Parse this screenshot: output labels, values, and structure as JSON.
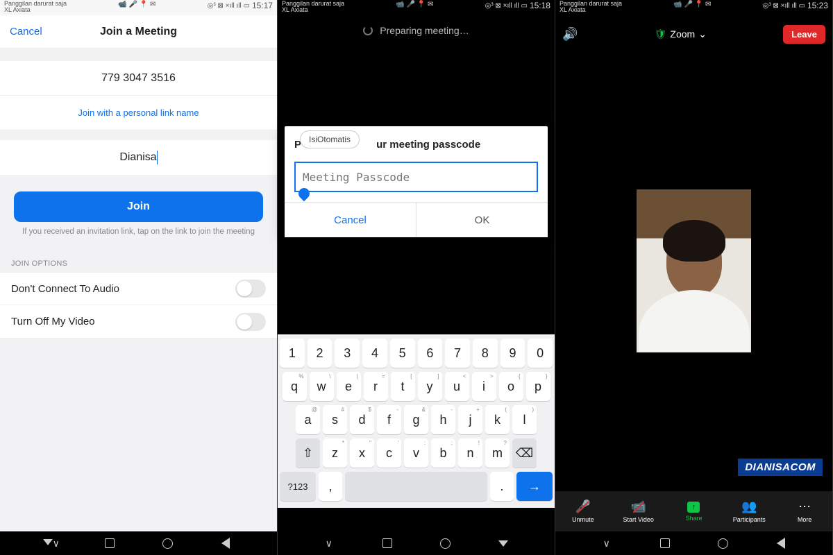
{
  "status": {
    "line1": "Panggilan darurat saja",
    "line2": "XL Axiata",
    "signal_text": "◎³ ⊠ ×ıll ıll ▭",
    "battery": "▭",
    "time1": "15:17",
    "time2": "15:18",
    "time3": "15:23",
    "left_icons": "📹 🎤 📍 ✉"
  },
  "panel1": {
    "cancel": "Cancel",
    "title": "Join a Meeting",
    "meeting_id": "779 3047 3516",
    "personal_link": "Join with a personal link name",
    "display_name": "Dianisa",
    "join_button": "Join",
    "hint": "If you received an invitation link, tap on the link to join the meeting",
    "section": "JOIN OPTIONS",
    "opt_audio": "Don't Connect To Audio",
    "opt_video": "Turn Off My Video"
  },
  "panel2": {
    "preparing": "Preparing meeting…",
    "dialog_title_full": "Please enter your meeting passcode",
    "dialog_title_left": "P",
    "dialog_title_right": "ur meeting passcode",
    "autofill": "IsiOtomatis",
    "placeholder": "Meeting Passcode",
    "cancel": "Cancel",
    "ok": "OK",
    "keys_row1": [
      "1",
      "2",
      "3",
      "4",
      "5",
      "6",
      "7",
      "8",
      "9",
      "0"
    ],
    "keys_row2": [
      {
        "k": "q",
        "s": "%"
      },
      {
        "k": "w",
        "s": "\\"
      },
      {
        "k": "e",
        "s": "|"
      },
      {
        "k": "r",
        "s": "="
      },
      {
        "k": "t",
        "s": "["
      },
      {
        "k": "y",
        "s": "]"
      },
      {
        "k": "u",
        "s": "<"
      },
      {
        "k": "i",
        "s": ">"
      },
      {
        "k": "o",
        "s": "{"
      },
      {
        "k": "p",
        "s": "}"
      }
    ],
    "keys_row3": [
      {
        "k": "a",
        "s": "@"
      },
      {
        "k": "s",
        "s": "#"
      },
      {
        "k": "d",
        "s": "$"
      },
      {
        "k": "f",
        "s": "-"
      },
      {
        "k": "g",
        "s": "&"
      },
      {
        "k": "h",
        "s": "-"
      },
      {
        "k": "j",
        "s": "+"
      },
      {
        "k": "k",
        "s": "("
      },
      {
        "k": "l",
        "s": ")"
      }
    ],
    "keys_row4": [
      {
        "k": "z",
        "s": "*"
      },
      {
        "k": "x",
        "s": "\""
      },
      {
        "k": "c",
        "s": "'"
      },
      {
        "k": "v",
        "s": ":"
      },
      {
        "k": "b",
        "s": ";"
      },
      {
        "k": "n",
        "s": "!"
      },
      {
        "k": "m",
        "s": "?"
      }
    ],
    "key_sym": "?123",
    "key_comma": ",",
    "key_dot": "."
  },
  "panel3": {
    "zoom_label": "Zoom",
    "leave": "Leave",
    "watermark": "DIANISACOM",
    "tools": {
      "unmute": "Unmute",
      "start_video": "Start Video",
      "share": "Share",
      "participants": "Participants",
      "more": "More"
    }
  }
}
